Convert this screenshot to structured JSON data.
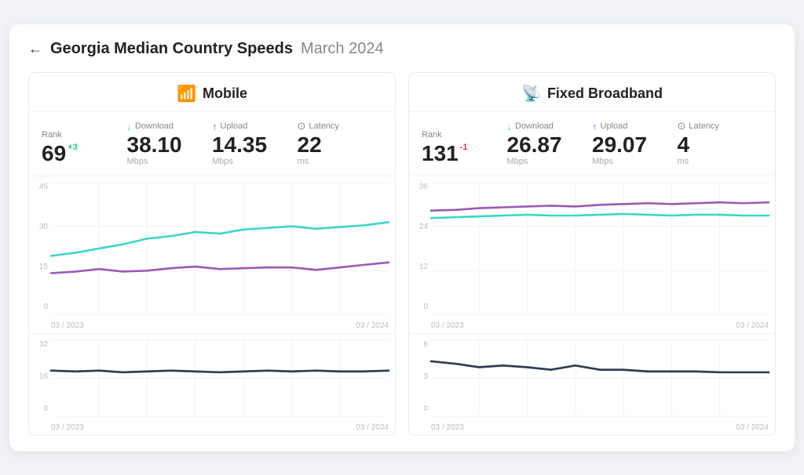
{
  "header": {
    "back_label": "←",
    "title": "Georgia Median Country Speeds",
    "subtitle": "March 2024"
  },
  "mobile": {
    "panel_title": "Mobile",
    "panel_icon": "📶",
    "rank_label": "Rank",
    "rank_value": "69",
    "rank_change": "+3",
    "rank_change_type": "positive",
    "download_label": "Download",
    "download_value": "38.10",
    "download_unit": "Mbps",
    "upload_label": "Upload",
    "upload_value": "14.35",
    "upload_unit": "Mbps",
    "latency_label": "Latency",
    "latency_value": "22",
    "latency_unit": "ms",
    "chart_y_labels": [
      "45",
      "30",
      "15",
      "0"
    ],
    "chart_y_labels_bottom": [
      "32",
      "16",
      "0"
    ],
    "chart_x_start": "03 / 2023",
    "chart_x_end": "03 / 2024"
  },
  "fixed": {
    "panel_title": "Fixed Broadband",
    "panel_icon": "📡",
    "rank_label": "Rank",
    "rank_value": "131",
    "rank_change": "-1",
    "rank_change_type": "negative",
    "download_label": "Download",
    "download_value": "26.87",
    "download_unit": "Mbps",
    "upload_label": "Upload",
    "upload_value": "29.07",
    "upload_unit": "Mbps",
    "latency_label": "Latency",
    "latency_value": "4",
    "latency_unit": "ms",
    "chart_y_labels": [
      "36",
      "24",
      "12",
      "0"
    ],
    "chart_y_labels_bottom": [
      "6",
      "3",
      "0"
    ],
    "chart_x_start": "03 / 2023",
    "chart_x_end": "03 / 2024"
  }
}
